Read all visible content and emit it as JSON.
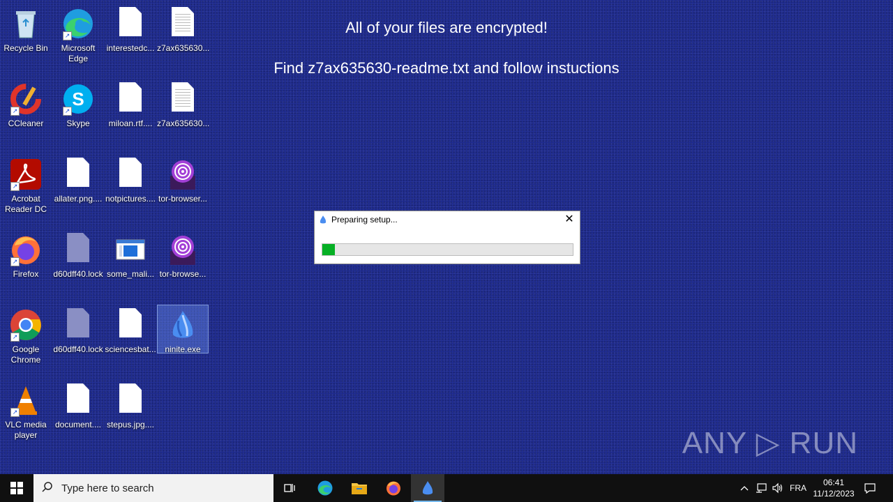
{
  "ransom_note": {
    "line1": "All of your files are encrypted!",
    "line2": "Find z7ax635630-readme.txt and follow instuctions"
  },
  "desktop_icons": {
    "recycle_bin": "Recycle Bin",
    "edge": "Microsoft Edge",
    "interested": "interestedc...",
    "z7ax_1": "z7ax635630...",
    "ccleaner": "CCleaner",
    "skype": "Skype",
    "miloan": "miloan.rtf....",
    "z7ax_2": "z7ax635630...",
    "acrobat": "Acrobat Reader DC",
    "allater": "allater.png....",
    "notpictures": "notpictures....",
    "tor_1": "tor-browser...",
    "firefox": "Firefox",
    "lock_1": "d60dff40.lock",
    "some_mali": "some_mali...",
    "tor_2": "tor-browse...",
    "chrome": "Google Chrome",
    "lock_2": "d60dff40.lock",
    "sciencesbat": "sciencesbat...",
    "ninite": "ninite.exe",
    "vlc": "VLC media player",
    "document": "document....",
    "stepus": "stepus.jpg...."
  },
  "dialog": {
    "title": "Preparing setup...",
    "close_glyph": "✕",
    "progress_fraction": 0.05
  },
  "watermark": "ANY ▷ RUN",
  "taskbar": {
    "search_placeholder": "Type here to search",
    "language": "FRA",
    "time": "06:41",
    "date": "11/12/2023"
  },
  "colors": {
    "desktop": "#1e2a8e",
    "progress": "#06b025"
  }
}
